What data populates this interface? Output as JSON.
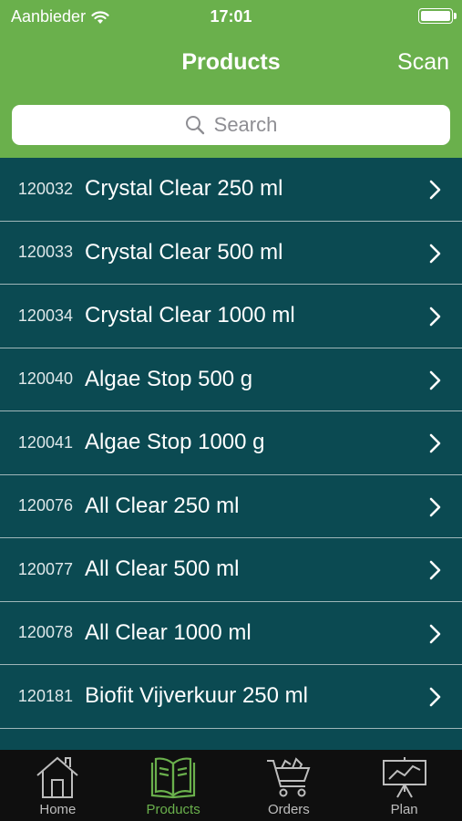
{
  "status_bar": {
    "carrier": "Aanbieder",
    "time": "17:01"
  },
  "nav": {
    "title": "Products",
    "scan_label": "Scan"
  },
  "search": {
    "placeholder": "Search"
  },
  "products": [
    {
      "code": "120032",
      "name": "Crystal Clear 250 ml"
    },
    {
      "code": "120033",
      "name": "Crystal Clear 500 ml"
    },
    {
      "code": "120034",
      "name": "Crystal Clear 1000 ml"
    },
    {
      "code": "120040",
      "name": "Algae Stop 500 g"
    },
    {
      "code": "120041",
      "name": "Algae Stop 1000 g"
    },
    {
      "code": "120076",
      "name": "All Clear 250 ml"
    },
    {
      "code": "120077",
      "name": "All Clear 500 ml"
    },
    {
      "code": "120078",
      "name": "All Clear 1000 ml"
    },
    {
      "code": "120181",
      "name": "Biofit Vijverkuur 250 ml"
    }
  ],
  "tabs": [
    {
      "label": "Home",
      "icon": "home-icon",
      "active": false
    },
    {
      "label": "Products",
      "icon": "book-icon",
      "active": true
    },
    {
      "label": "Orders",
      "icon": "cart-icon",
      "active": false
    },
    {
      "label": "Plan",
      "icon": "presentation-icon",
      "active": false
    }
  ],
  "colors": {
    "header_green": "#6ab04c",
    "list_background": "#0b4a52",
    "tabbar_background": "#0f0f0f",
    "active_tab": "#6ab04c"
  }
}
